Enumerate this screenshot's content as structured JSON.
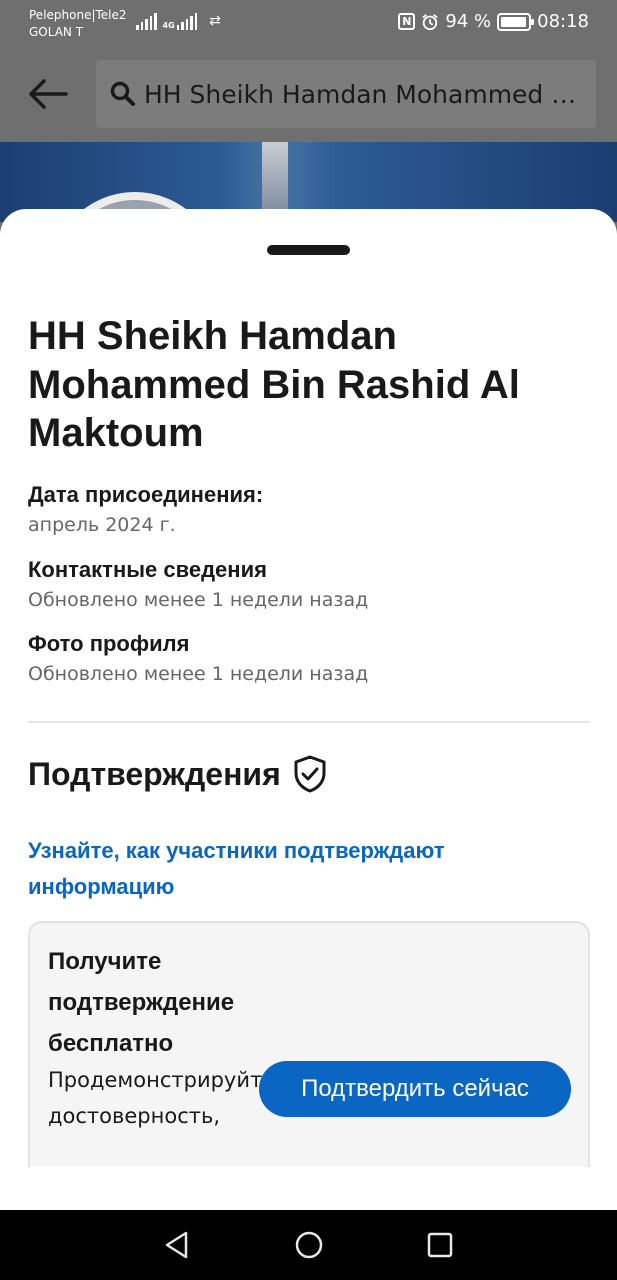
{
  "status_bar": {
    "carrier_line1": "Pelephone|Tele2",
    "carrier_line2": "GOLAN T",
    "network": "4G",
    "battery_percent": "94 %",
    "battery_level": 0.94,
    "time": "08:18",
    "icons": [
      "signal-icon",
      "signal-4g-icon",
      "data-transfer-icon",
      "nfc-icon",
      "alarm-icon",
      "battery-icon"
    ]
  },
  "header": {
    "back_icon": "back-arrow-icon",
    "search_icon": "search-icon",
    "search_text": "HH Sheikh Hamdan Mohammed Bin Rashid Al Maktoum"
  },
  "sheet": {
    "profile_name": "HH Sheikh Hamdan Mohammed Bin Rashid Al Maktoum",
    "info": [
      {
        "title": "Дата присоединения:",
        "value": "апрель 2024 г."
      },
      {
        "title": "Контактные сведения",
        "value": "Обновлено менее 1 недели назад"
      },
      {
        "title": "Фото профиля",
        "value": "Обновлено менее 1 недели назад"
      }
    ],
    "verifications_title": "Подтверждения",
    "learn_link": "Узнайте, как участники подтверждают информацию",
    "card": {
      "title": "Получите подтверждение бесплатно",
      "description": "Продемонстрируйте достоверность,",
      "button_label": "Подтвердить сейчас"
    },
    "colors": {
      "link": "#0a66c2",
      "button": "#0a66c2",
      "text": "#191919",
      "muted": "#666666"
    }
  },
  "nav_bar": {
    "icons": [
      "nav-back-icon",
      "nav-home-icon",
      "nav-recents-icon"
    ]
  }
}
